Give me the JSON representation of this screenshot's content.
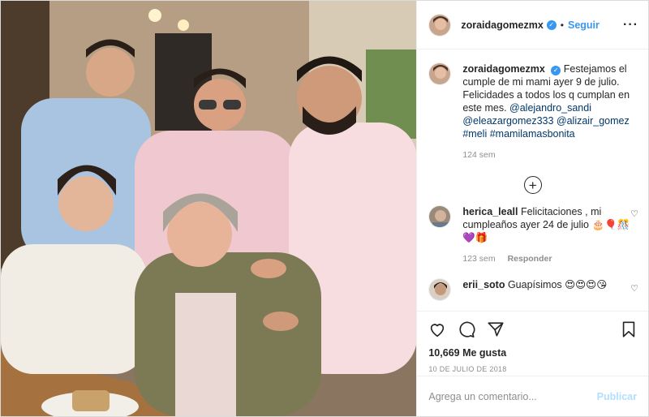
{
  "post": {
    "author": "zoraidagomezmx",
    "verified": true,
    "follow_label": "Seguir",
    "more_icon": "more-options-icon",
    "separator": "•"
  },
  "caption": {
    "user": "zoraidagomezmx",
    "text": "Festejamos el cumple de mi mami ayer 9 de julio. Felicidades a todos los q cumplan en este mes.",
    "mentions": [
      "@alejandro_sandi",
      "@eleazargomez333",
      "@alizair_gomez",
      "#meli",
      "#mamilamasbonita"
    ],
    "time": "124 sem"
  },
  "load_more_icon": "plus-circle-icon",
  "comments": [
    {
      "user": "herica_leall",
      "text": "Felicitaciones , mi cumpleaños ayer 24 de julio 🎂🎈🎊💜🎁",
      "time": "123 sem",
      "reply_label": "Responder"
    },
    {
      "user": "erii_soto",
      "text": "Guapísimos 😍😍😍😘"
    }
  ],
  "actions": {
    "like_icon": "heart-icon",
    "comment_icon": "comment-icon",
    "share_icon": "share-icon",
    "save_icon": "bookmark-icon"
  },
  "likes_label": "10,669 Me gusta",
  "date": "10 DE JULIO DE 2018",
  "add_comment": {
    "placeholder": "Agrega un comentario...",
    "publish_label": "Publicar"
  },
  "colors": {
    "accent": "#3897f0",
    "publish_disabled": "#b2dffc",
    "muted": "#8e8e8e"
  }
}
